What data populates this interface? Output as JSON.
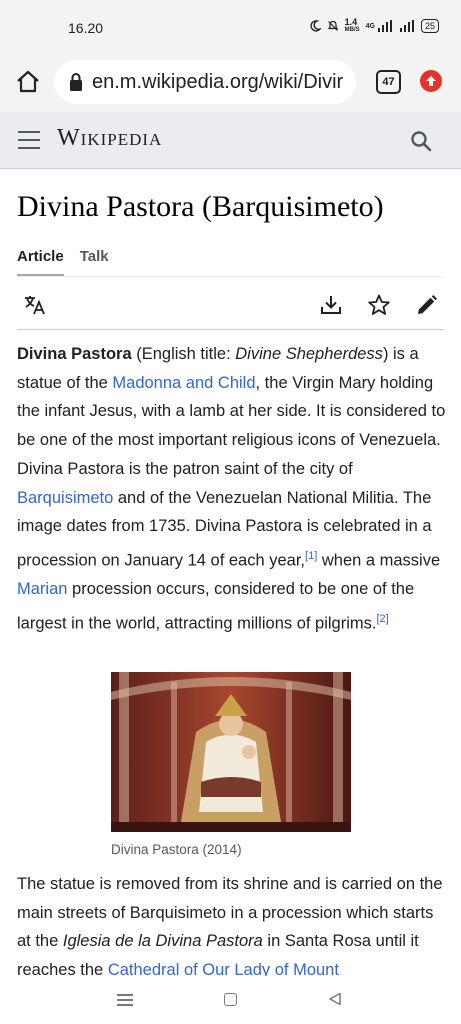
{
  "status_bar": {
    "time": "16.20",
    "net_speed": "1.4",
    "net_unit": "MB/S",
    "network": "4G",
    "battery": "25"
  },
  "browser": {
    "url": "en.m.wikipedia.org/wiki/Divir",
    "tab_count": "47"
  },
  "wiki_header": {
    "logo": "Wikipedia"
  },
  "article": {
    "title": "Divina Pastora (Barquisimeto)",
    "tabs": [
      {
        "label": "Article",
        "active": true
      },
      {
        "label": "Talk",
        "active": false
      }
    ],
    "p1": {
      "bold": "Divina Pastora",
      "t1": " (English title: ",
      "i1": "Divine Shepherdess",
      "t2": ") is a statue of the ",
      "l1": "Madonna and Child",
      "t3": ", the Virgin Mary holding the infant Jesus, with a lamb at her side. It is considered to be one of the most important religious icons of Venezuela. Divina Pastora is the patron saint of the city of ",
      "l2": "Barquisimeto",
      "t4": " and of the Venezuelan National Militia. The image dates from 1735. Divina Pastora is celebrated in a procession on January 14 of each year,",
      "ref1": "[1]",
      "t5": " when a massive ",
      "l3": "Marian",
      "t6": " procession occurs, considered to be one of the largest in the world, attracting millions of pilgrims.",
      "ref2": "[2]"
    },
    "figure_caption": "Divina Pastora (2014)",
    "p2": {
      "t1": "The statue is removed from its shrine and is carried on the main streets of Barquisimeto in a procession which starts at the ",
      "i1": "Iglesia de la Divina Pastora",
      "t2": " in Santa Rosa until it reaches the ",
      "l1": "Cathedral of Our Lady of Mount"
    }
  },
  "colors": {
    "link": "#3366cc",
    "header_bg": "#eaecf0",
    "text": "#202122",
    "badge_red": "#e5322d"
  }
}
